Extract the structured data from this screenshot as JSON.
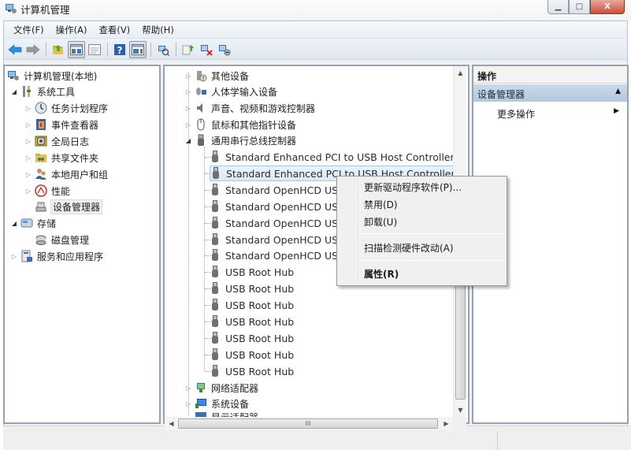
{
  "window": {
    "title": "计算机管理",
    "controls": {
      "minimize": "▭",
      "maximize": "□",
      "close": "X"
    }
  },
  "menubar": {
    "items": [
      "文件(F)",
      "操作(A)",
      "查看(V)",
      "帮助(H)"
    ]
  },
  "toolbar": {
    "buttons": [
      "back-arrow-icon",
      "forward-arrow-icon",
      "up-folder-icon",
      "show-hide-console-tree-icon",
      "properties-sheet-icon",
      "help-icon",
      "show-hide-action-pane-icon",
      "scan-hardware-icon",
      "update-driver-icon",
      "uninstall-device-icon",
      "disable-device-icon"
    ]
  },
  "console_tree": {
    "items": [
      {
        "label": "计算机管理(本地)",
        "icon": "computer-management-icon",
        "expander": "",
        "level": 0
      },
      {
        "label": "系统工具",
        "icon": "system-tools-icon",
        "expander": "open",
        "level": 1
      },
      {
        "label": "任务计划程序",
        "icon": "task-scheduler-icon",
        "expander": "closed",
        "level": 2
      },
      {
        "label": "事件查看器",
        "icon": "event-viewer-icon",
        "expander": "closed",
        "level": 2
      },
      {
        "label": "全局日志",
        "icon": "global-log-icon",
        "expander": "closed",
        "level": 2
      },
      {
        "label": "共享文件夹",
        "icon": "shared-folders-icon",
        "expander": "closed",
        "level": 2
      },
      {
        "label": "本地用户和组",
        "icon": "local-users-groups-icon",
        "expander": "closed",
        "level": 2
      },
      {
        "label": "性能",
        "icon": "performance-icon",
        "expander": "closed",
        "level": 2
      },
      {
        "label": "设备管理器",
        "icon": "device-manager-icon",
        "expander": "",
        "level": 2,
        "selected": true
      },
      {
        "label": "存储",
        "icon": "storage-icon",
        "expander": "open",
        "level": 1
      },
      {
        "label": "磁盘管理",
        "icon": "disk-management-icon",
        "expander": "",
        "level": 2
      },
      {
        "label": "服务和应用程序",
        "icon": "services-apps-icon",
        "expander": "closed",
        "level": 1
      }
    ]
  },
  "device_tree": {
    "categories_top": [
      {
        "label": "其他设备",
        "icon": "other-devices-icon"
      },
      {
        "label": "人体学输入设备",
        "icon": "hid-icon"
      },
      {
        "label": "声音、视频和游戏控制器",
        "icon": "sound-icon"
      },
      {
        "label": "鼠标和其他指针设备",
        "icon": "mouse-icon"
      }
    ],
    "expanded_category": {
      "label": "通用串行总线控制器",
      "icon": "usb-icon"
    },
    "usb_children": [
      "Standard Enhanced PCI to USB Host Controller",
      "Standard Enhanced PCI to USB Host Controller",
      "Standard OpenHCD USB Host Controller",
      "Standard OpenHCD USB Host Controller",
      "Standard OpenHCD USB Host Controller",
      "Standard OpenHCD USB Host Controller",
      "Standard OpenHCD USB Host Controller",
      "USB Root Hub",
      "USB Root Hub",
      "USB Root Hub",
      "USB Root Hub",
      "USB Root Hub",
      "USB Root Hub",
      "USB Root Hub"
    ],
    "highlighted_index": 1,
    "categories_bottom": [
      {
        "label": "网络适配器",
        "icon": "network-adapter-icon"
      },
      {
        "label": "系统设备",
        "icon": "system-devices-icon"
      },
      {
        "label": "显示适配器",
        "icon": "display-adapter-icon"
      }
    ],
    "hscroll_grip": "III"
  },
  "actions_pane": {
    "header": "操作",
    "section": "设备管理器",
    "items": [
      {
        "label": "更多操作"
      }
    ]
  },
  "context_menu": {
    "items": [
      {
        "label": "更新驱动程序软件(P)...",
        "bold": false
      },
      {
        "label": "禁用(D)",
        "bold": false
      },
      {
        "label": "卸载(U)",
        "bold": false
      },
      {
        "separator": true
      },
      {
        "label": "扫描检测硬件改动(A)",
        "bold": false
      },
      {
        "separator": true
      },
      {
        "label": "属性(R)",
        "bold": true
      }
    ]
  },
  "colors": {
    "selection_bg": "#d9e9f8",
    "action_section_bg": "#b4c9df",
    "close_button": "#c7503a"
  }
}
